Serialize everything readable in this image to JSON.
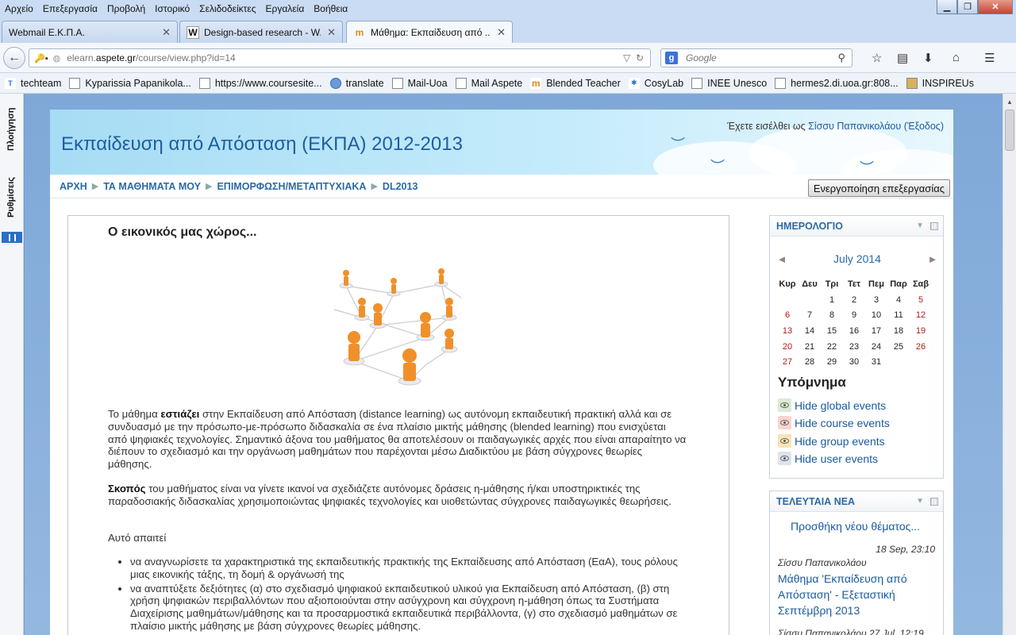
{
  "menubar": {
    "items": [
      "Αρχείο",
      "Επεξεργασία",
      "Προβολή",
      "Ιστορικό",
      "Σελιδοδείκτες",
      "Εργαλεία",
      "Βοήθεια"
    ]
  },
  "tabs": [
    {
      "label": "Webmail Ε.Κ.Π.Α.",
      "icon": "globe-icon"
    },
    {
      "label": "Design-based research - W...",
      "icon": "wikipedia-icon"
    },
    {
      "label": "Μάθημα: Εκπαίδευση από ...",
      "icon": "moodle-icon"
    }
  ],
  "navbar": {
    "url_prefix": "elearn.",
    "url_domain": "aspete.gr",
    "url_path": "/course/view.php?id=14",
    "search_placeholder": "Google"
  },
  "bookmarks": [
    {
      "label": "techteam",
      "icon": "techteam-icon"
    },
    {
      "label": "Kyparissia Papanikola...",
      "icon": "page-icon"
    },
    {
      "label": "https://www.coursesite...",
      "icon": "page-icon"
    },
    {
      "label": "translate",
      "icon": "globe-icon"
    },
    {
      "label": "Mail-Uoa",
      "icon": "page-icon"
    },
    {
      "label": "Mail Aspete",
      "icon": "page-icon"
    },
    {
      "label": "Blended Teacher",
      "icon": "moodle-icon"
    },
    {
      "label": "CosyLab",
      "icon": "cosylab-icon"
    },
    {
      "label": "INEE Unesco",
      "icon": "page-icon"
    },
    {
      "label": "hermes2.di.uoa.gr:808...",
      "icon": "page-icon"
    },
    {
      "label": "INSPIREUs",
      "icon": "image-icon"
    }
  ],
  "sidebar": {
    "navigation_label": "Πλοήγηση",
    "settings_label": "Ρυθμίσεις"
  },
  "header": {
    "site_title": "Εκπαίδευση από Απόσταση (ΕΚΠΑ) 2012-2013",
    "login_prefix": "Έχετε εισέλθει ως",
    "user_name": "Σίσσυ Παπανικολάου",
    "logout": "(Έξοδος)"
  },
  "breadcrumb": {
    "items": [
      "ΑΡΧΗ",
      "ΤΑ ΜΑΘΗΜΑΤΑ ΜΟΥ",
      "ΕΠΙΜΟΡΦΩΣΗ/ΜΕΤΑΠΤΥΧΙΑΚΑ",
      "DL2013"
    ],
    "edit_button": "Ενεργοποίηση επεξεργασίας"
  },
  "main": {
    "section_title": "Ο εικονικός μας χώρος...",
    "p1_before": "Το μάθημα",
    "p1_bold": "εστιάζει",
    "p1_after": "στην Εκπαίδευση από Απόσταση (distance learning) ως αυτόνομη εκπαιδευτική πρακτική αλλά και σε συνδυασμό με την πρόσωπο-με-πρόσωπο διδασκαλία σε ένα πλαίσιο μικτής μάθησης (blended learning) που ενισχύεται από ψηφιακές τεχνολογίες. Σημαντικό άξονα του μαθήματος θα αποτελέσουν οι παιδαγωγικές αρχές που είναι απαραίτητο να διέπουν το σχεδιασμό και την οργάνωση μαθημάτων που παρέχονται μέσω Διαδικτύου με βάση σύγχρονες θεωρίες μάθησης.",
    "p2_bold": "Σκοπός",
    "p2_after": "του μαθήματος είναι να γίνετε ικανοί να σχεδιάζετε αυτόνομες δράσεις η-μάθησης ή/και υποστηρικτικές της παραδοσιακής διδασκαλίας χρησιμοποιώντας ψηφιακές τεχνολογίες και υιοθετώντας σύγχρονες παιδαγωγικές θεωρήσεις.",
    "p3": "Αυτό απαιτεί",
    "bullets": [
      "να αναγνωρίσετε τα χαρακτηριστικά της εκπαιδευτικής πρακτικής της Εκπαίδευσης από Απόσταση (ΕαΑ), τους ρόλους μιας εικονικής τάξης, τη δομή & οργάνωσή της",
      "να αναπτύξετε δεξιότητες (α) στο σχεδιασμό ψηφιακού εκπαιδευτικού υλικού για Εκπαίδευση από Απόσταση, (β) στη χρήση ψηφιακών περιβαλλόντων που αξιοποιούνται στην ασύγχρονη και σύγχρονη η-μάθηση όπως τα Συστήματα Διαχείρισης μαθημάτων/μάθησης και τα προσαρμοστικά εκπαιδευτικά περιβάλλοντα, (γ) στο σχεδιασμό μαθημάτων σε πλαίσιο μικτής μάθησης με βάση σύγχρονες θεωρίες μάθησης."
    ]
  },
  "calendar": {
    "title": "ΗΜΕΡΟΛΟΓΙΟ",
    "month": "July 2014",
    "prev": "◄",
    "next": "►",
    "weekdays": [
      "Κυρ",
      "Δευ",
      "Τρι",
      "Τετ",
      "Πεμ",
      "Παρ",
      "Σαβ"
    ],
    "weeks": [
      [
        "",
        "",
        "1",
        "2",
        "3",
        "4",
        "5"
      ],
      [
        "6",
        "7",
        "8",
        "9",
        "10",
        "11",
        "12"
      ],
      [
        "13",
        "14",
        "15",
        "16",
        "17",
        "18",
        "19"
      ],
      [
        "20",
        "21",
        "22",
        "23",
        "24",
        "25",
        "26"
      ],
      [
        "27",
        "28",
        "29",
        "30",
        "31",
        "",
        ""
      ]
    ],
    "legend_title": "Υπόμνημα",
    "legend": [
      {
        "label": "Hide global events",
        "color": "#d9ecd3"
      },
      {
        "label": "Hide course events",
        "color": "#f8d4cf"
      },
      {
        "label": "Hide group events",
        "color": "#fbe3b6"
      },
      {
        "label": "Hide user events",
        "color": "#dde3ee"
      }
    ]
  },
  "news": {
    "title": "ΤΕΛΕΥΤΑΙΑ ΝΕΑ",
    "add_topic": "Προσθήκη νέου θέματος...",
    "date1": "18 Sep, 23:10",
    "author1": "Σίσσυ Παπανικολάου",
    "topic1": "Μάθημα 'Εκπαίδευση από Απόσταση' - Εξεταστική Σεπτέμβρη 2013",
    "next_partial": "Σίσσυ Παπανικολάου 27 Jul, 12:19"
  }
}
